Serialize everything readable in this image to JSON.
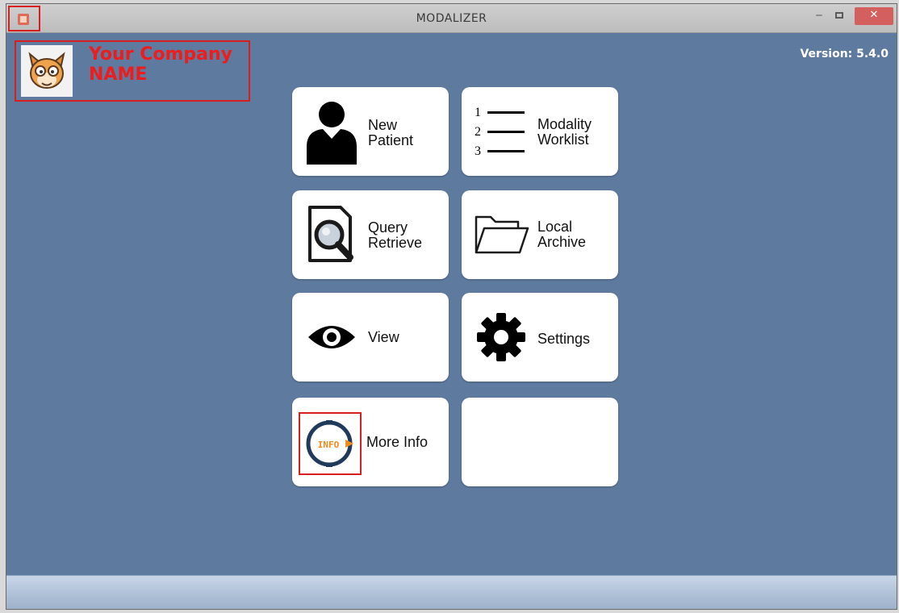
{
  "window": {
    "title": "MODALIZER",
    "minimize_label": "‒",
    "close_label": "✕"
  },
  "branding": {
    "company_line1": "Your Company",
    "company_line2": "NAME",
    "version": "Version: 5.4.0"
  },
  "tiles": [
    {
      "icon": "person-icon",
      "line1": "New",
      "line2": "Patient"
    },
    {
      "icon": "numbered-list-icon",
      "line1": "Modality",
      "line2": "Worklist"
    },
    {
      "icon": "document-search-icon",
      "line1": "Query",
      "line2": "Retrieve"
    },
    {
      "icon": "folder-icon",
      "line1": "Local",
      "line2": "Archive"
    },
    {
      "icon": "eye-icon",
      "line1": "View",
      "line2": ""
    },
    {
      "icon": "gear-icon",
      "line1": "Settings",
      "line2": ""
    },
    {
      "icon": "info-icon",
      "line1": "More Info",
      "line2": ""
    },
    {
      "icon": "",
      "line1": "",
      "line2": ""
    }
  ],
  "info_icon_text": "INFO",
  "worklist_numbers": [
    "1",
    "2",
    "3"
  ],
  "colors": {
    "background": "#5e7a9e",
    "company_red": "#ee1c1c",
    "info_orange": "#f28a1c"
  }
}
